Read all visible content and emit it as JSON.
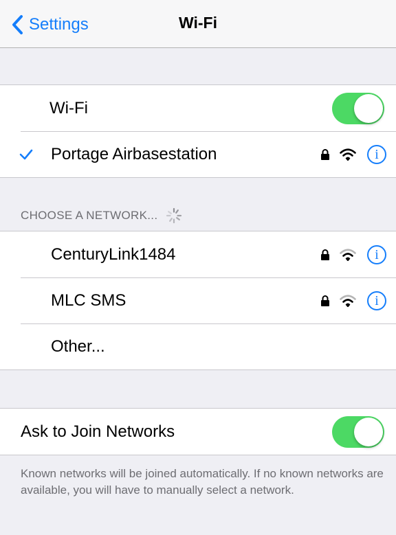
{
  "navbar": {
    "back_label": "Settings",
    "title": "Wi-Fi"
  },
  "wifi_group": {
    "toggle_label": "Wi-Fi",
    "toggle_on": true,
    "connected_network": "Portage Airbasestation"
  },
  "choose_header": "CHOOSE A NETWORK...",
  "networks": [
    {
      "name": "CenturyLink1484",
      "secured": true
    },
    {
      "name": "MLC SMS",
      "secured": true
    }
  ],
  "other_label": "Other...",
  "ask_join": {
    "label": "Ask to Join Networks",
    "toggle_on": true
  },
  "footer_text": "Known networks will be joined automatically. If no known networks are available, you will have to manually select a network.",
  "colors": {
    "accent": "#157efb",
    "toggle_on": "#4cd964",
    "background": "#efeff4"
  },
  "info_glyph": "i"
}
